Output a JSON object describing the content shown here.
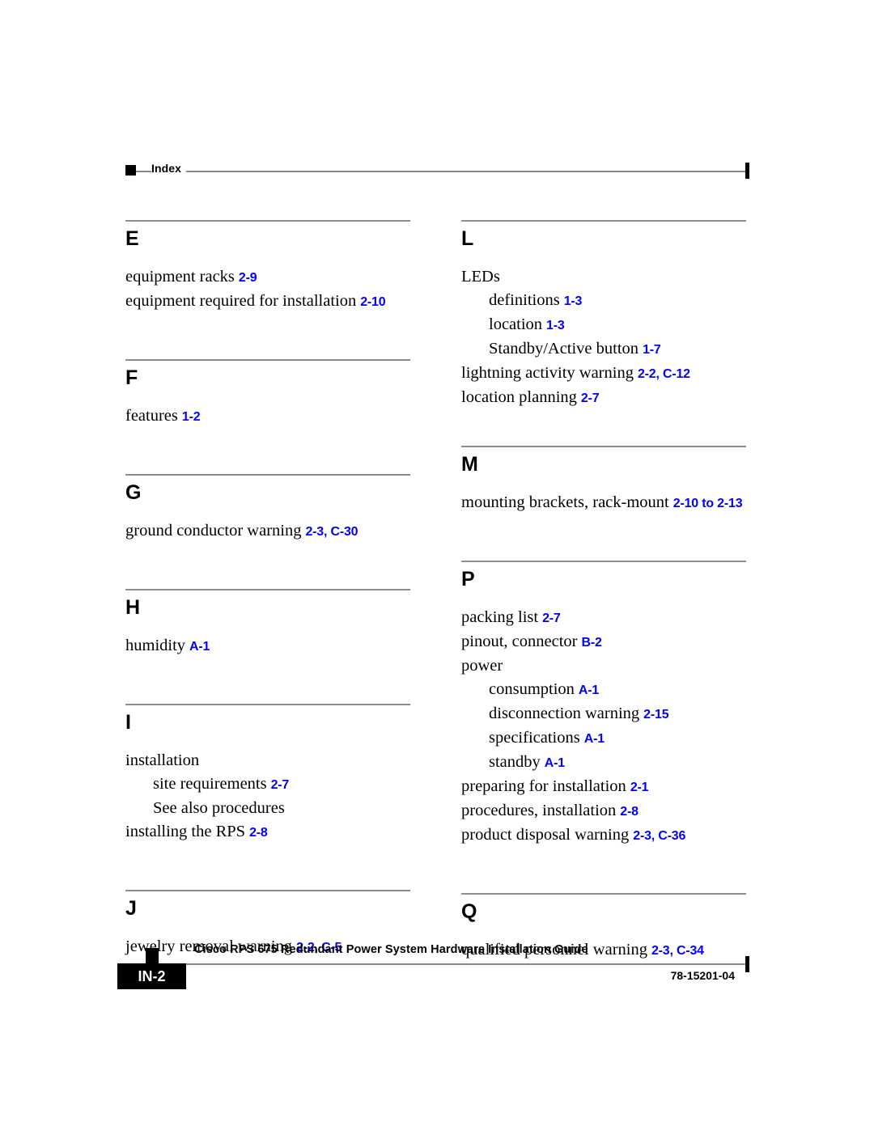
{
  "header": {
    "label": "Index"
  },
  "footer": {
    "page_number": "IN-2",
    "document_title": "Cisco RPS 675 Redundant Power System Hardware Installation Guide",
    "document_number": "78-15201-04"
  },
  "colors": {
    "reference_link": "#0000FF",
    "rule": "#8A8A8A",
    "text": "#000000"
  },
  "index": {
    "left_column": [
      {
        "letter": "E",
        "entries": [
          {
            "level": 1,
            "text": "equipment racks",
            "refs": "2-9"
          },
          {
            "level": 1,
            "text": "equipment required for installation",
            "refs": "2-10"
          }
        ]
      },
      {
        "letter": "F",
        "entries": [
          {
            "level": 1,
            "text": "features",
            "refs": "1-2"
          }
        ]
      },
      {
        "letter": "G",
        "entries": [
          {
            "level": 1,
            "text": "ground conductor warning",
            "refs": "2-3, C-30"
          }
        ]
      },
      {
        "letter": "H",
        "entries": [
          {
            "level": 1,
            "text": "humidity",
            "refs": "A-1"
          }
        ]
      },
      {
        "letter": "I",
        "entries": [
          {
            "level": 1,
            "text": "installation",
            "refs": ""
          },
          {
            "level": 2,
            "text": "site requirements",
            "refs": "2-7"
          },
          {
            "level": 2,
            "text": "See also procedures",
            "refs": ""
          },
          {
            "level": 1,
            "text": "installing the RPS",
            "refs": "2-8"
          }
        ]
      },
      {
        "letter": "J",
        "entries": [
          {
            "level": 1,
            "text": "jewelry removal warning",
            "refs": "2-2, C-5"
          }
        ]
      }
    ],
    "right_column": [
      {
        "letter": "L",
        "entries": [
          {
            "level": 1,
            "text": "LEDs",
            "refs": ""
          },
          {
            "level": 2,
            "text": "definitions",
            "refs": "1-3"
          },
          {
            "level": 2,
            "text": "location",
            "refs": "1-3"
          },
          {
            "level": 2,
            "text": "Standby/Active button",
            "refs": "1-7"
          },
          {
            "level": 1,
            "text": "lightning activity warning",
            "refs": "2-2, C-12"
          },
          {
            "level": 1,
            "text": "location planning",
            "refs": "2-7"
          }
        ]
      },
      {
        "letter": "M",
        "entries": [
          {
            "level": 1,
            "text": "mounting brackets, rack-mount",
            "refs": "2-10 to 2-13"
          }
        ]
      },
      {
        "letter": "P",
        "entries": [
          {
            "level": 1,
            "text": "packing list",
            "refs": "2-7"
          },
          {
            "level": 1,
            "text": "pinout, connector",
            "refs": "B-2"
          },
          {
            "level": 1,
            "text": "power",
            "refs": ""
          },
          {
            "level": 2,
            "text": "consumption",
            "refs": "A-1"
          },
          {
            "level": 2,
            "text": "disconnection warning",
            "refs": "2-15"
          },
          {
            "level": 2,
            "text": "specifications",
            "refs": "A-1"
          },
          {
            "level": 2,
            "text": "standby",
            "refs": "A-1"
          },
          {
            "level": 1,
            "text": "preparing for installation",
            "refs": "2-1"
          },
          {
            "level": 1,
            "text": "procedures, installation",
            "refs": "2-8"
          },
          {
            "level": 1,
            "text": "product disposal warning",
            "refs": "2-3, C-36"
          }
        ]
      },
      {
        "letter": "Q",
        "entries": [
          {
            "level": 1,
            "text": "qualified personnel warning",
            "refs": "2-3, C-34"
          }
        ]
      }
    ]
  }
}
